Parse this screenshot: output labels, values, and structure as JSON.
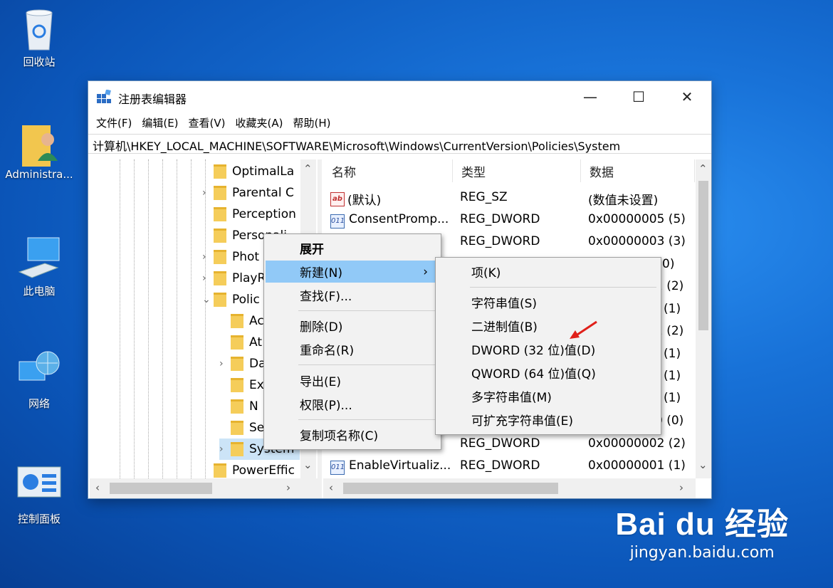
{
  "desktop": {
    "icons": [
      {
        "label": "回收站",
        "icon": "recycle-bin-icon"
      },
      {
        "label": "Administra...",
        "icon": "user-folder-icon"
      },
      {
        "label": "此电脑",
        "icon": "computer-icon"
      },
      {
        "label": "网络",
        "icon": "network-icon"
      },
      {
        "label": "控制面板",
        "icon": "control-panel-icon"
      }
    ]
  },
  "window": {
    "title": "注册表编辑器",
    "controls": {
      "minimize": "—",
      "maximize": "☐",
      "close": "✕"
    },
    "menu": [
      "文件(F)",
      "编辑(E)",
      "查看(V)",
      "收藏夹(A)",
      "帮助(H)"
    ],
    "address": "计算机\\HKEY_LOCAL_MACHINE\\SOFTWARE\\Microsoft\\Windows\\CurrentVersion\\Policies\\System"
  },
  "tree": [
    {
      "label": "OptimalLa"
    },
    {
      "label": "Parental C"
    },
    {
      "label": "Perception"
    },
    {
      "label": "Personali"
    },
    {
      "label": "Phot"
    },
    {
      "label": "PlayR"
    },
    {
      "label": "Polic"
    },
    {
      "label": "Ac"
    },
    {
      "label": "At"
    },
    {
      "label": "Da"
    },
    {
      "label": "Ex"
    },
    {
      "label": "N"
    },
    {
      "label": "Se"
    },
    {
      "label": "System"
    },
    {
      "label": "PowerEffic"
    }
  ],
  "list": {
    "headers": [
      "名称",
      "类型",
      "数据"
    ],
    "rows": [
      {
        "name": "(默认)",
        "type": "REG_SZ",
        "data": "(数值未设置)",
        "icon": "ab"
      },
      {
        "name": "ConsentPromp...",
        "type": "REG_DWORD",
        "data": "0x00000005 (5)",
        "icon": "bin"
      },
      {
        "name": "",
        "type": "REG_DWORD",
        "data": "0x00000003 (3)",
        "icon": "bin"
      },
      {
        "name": "",
        "type": "",
        "data": "0)",
        "icon": ""
      },
      {
        "name": "",
        "type": "",
        "data": "2 (2)",
        "icon": ""
      },
      {
        "name": "",
        "type": "",
        "data": "(1)",
        "icon": ""
      },
      {
        "name": "",
        "type": "",
        "data": "2 (2)",
        "icon": ""
      },
      {
        "name": "",
        "type": "",
        "data": "(1)",
        "icon": ""
      },
      {
        "name": "",
        "type": "",
        "data": "(1)",
        "icon": ""
      },
      {
        "name": "",
        "type": "",
        "data": "(1)",
        "icon": ""
      },
      {
        "name": "",
        "type": "",
        "data": "0 (0)",
        "icon": ""
      },
      {
        "name": "",
        "type": "REG_DWORD",
        "data": "0x00000002 (2)",
        "icon": ""
      },
      {
        "name": "EnableVirtualiz...",
        "type": "REG_DWORD",
        "data": "0x00000001 (1)",
        "icon": "bin"
      }
    ]
  },
  "context_menu": {
    "items": [
      "展开",
      "新建(N)",
      "查找(F)...",
      "删除(D)",
      "重命名(R)",
      "导出(E)",
      "权限(P)...",
      "复制项名称(C)"
    ],
    "submenu_arrow": "›"
  },
  "submenu": {
    "items": [
      "项(K)",
      "字符串值(S)",
      "二进制值(B)",
      "DWORD (32 位)值(D)",
      "QWORD (64 位)值(Q)",
      "多字符串值(M)",
      "可扩充字符串值(E)"
    ]
  },
  "watermark": {
    "logo": "Bai du 经验",
    "url": "jingyan.baidu.com"
  },
  "colors": {
    "highlight": "#91c9f7",
    "annotation_arrow": "#e0201a"
  }
}
